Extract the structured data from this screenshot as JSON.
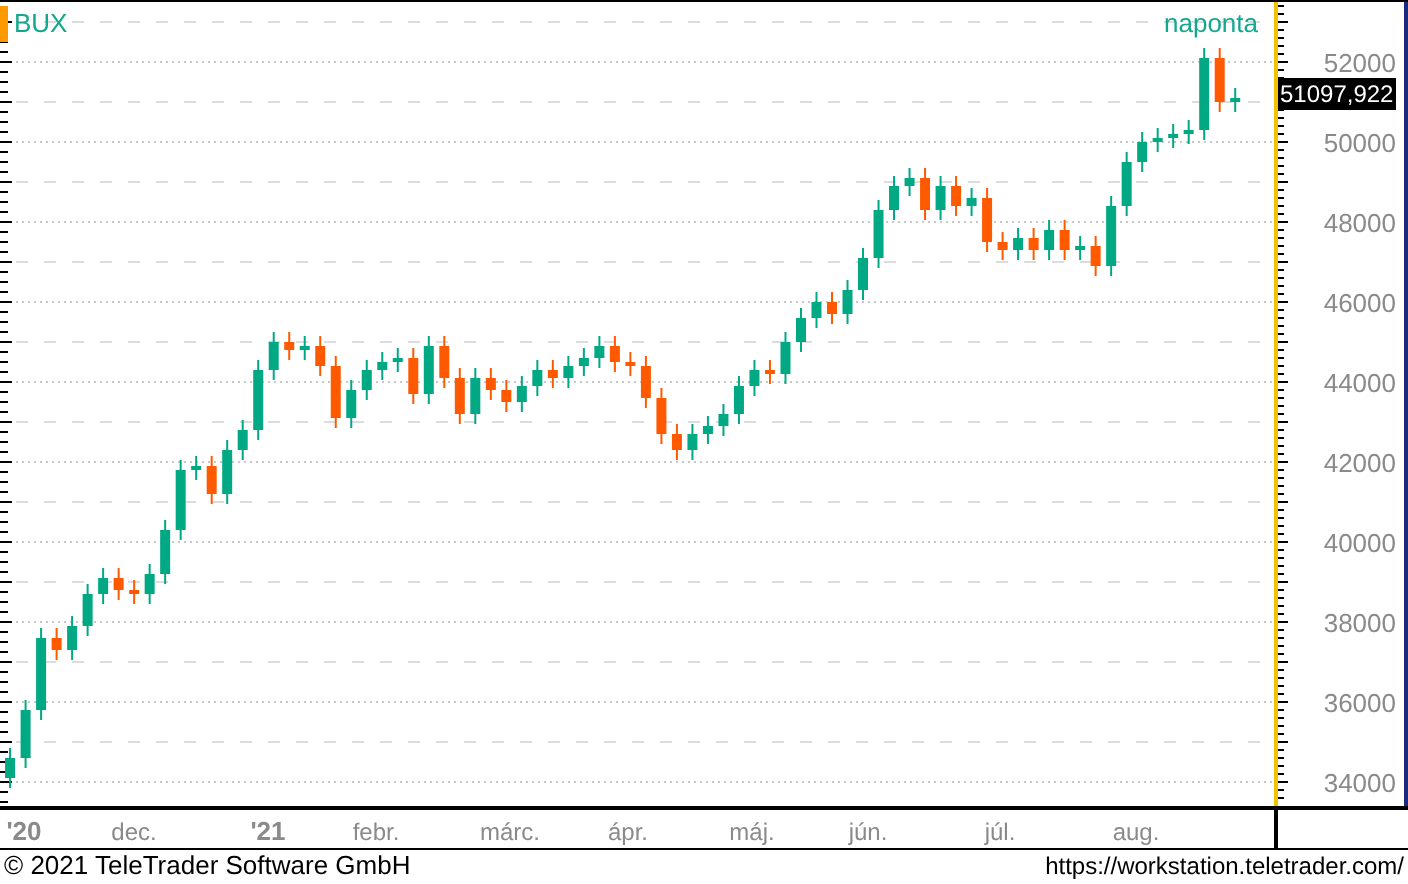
{
  "chart": {
    "symbol": "BUX",
    "interval": "naponta",
    "last_value": "51097,922",
    "y_axis_labels": [
      "52000",
      "50000",
      "48000",
      "46000",
      "44000",
      "42000",
      "40000",
      "38000",
      "36000",
      "34000"
    ],
    "x_axis_labels": [
      {
        "text": "'20",
        "kind": "year"
      },
      {
        "text": "dec.",
        "kind": "month"
      },
      {
        "text": "'21",
        "kind": "year"
      },
      {
        "text": "febr.",
        "kind": "month"
      },
      {
        "text": "márc.",
        "kind": "month"
      },
      {
        "text": "ápr.",
        "kind": "month"
      },
      {
        "text": "máj.",
        "kind": "month"
      },
      {
        "text": "jún.",
        "kind": "month"
      },
      {
        "text": "júl.",
        "kind": "month"
      },
      {
        "text": "aug.",
        "kind": "month"
      }
    ]
  },
  "footer": {
    "copyright": "© 2021 TeleTrader Software GmbH",
    "url": "https://workstation.teletrader.com/"
  }
}
